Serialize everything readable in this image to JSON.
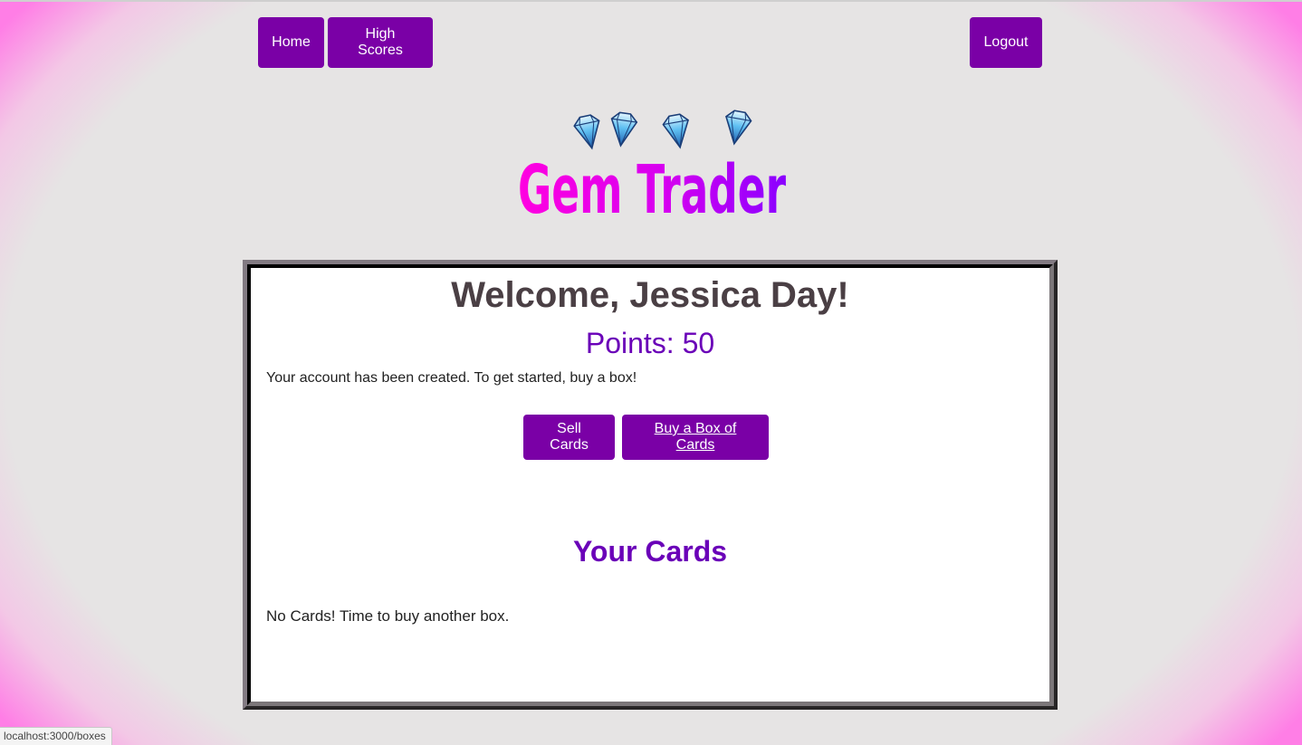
{
  "nav": {
    "home_label": "Home",
    "high_scores_label": "High Scores",
    "logout_label": "Logout"
  },
  "logo": {
    "text": "Gem Trader",
    "icon": "diamond-icon",
    "gem_count": 4,
    "colors": {
      "start": "#ff00e0",
      "end": "#8a00ff",
      "gem": "#4fb6ef"
    }
  },
  "panel": {
    "welcome_text": "Welcome, Jessica Day!",
    "points_text": "Points: 50",
    "message": "Your account has been created. To get started, buy a box!",
    "sell_button_label": "Sell Cards",
    "buy_button_label": "Buy a Box of Cards",
    "cards_heading": "Your Cards",
    "no_cards_text": "No Cards! Time to buy another box."
  },
  "status_bar": {
    "url": "localhost:3000/boxes"
  },
  "colors": {
    "accent": "#7a00a6",
    "heading_purple": "#6a00b8",
    "welcome_text": "#4a3f44",
    "background": "#e6e4e4",
    "edge_pink": "#ff7ee6"
  }
}
